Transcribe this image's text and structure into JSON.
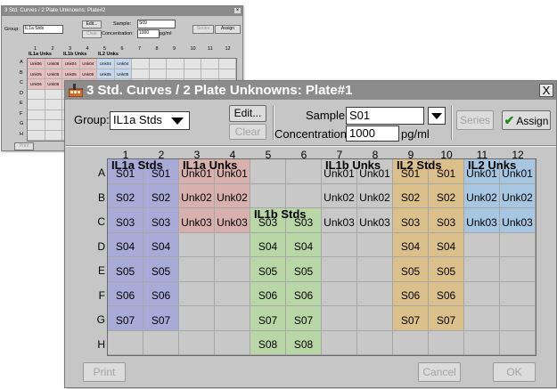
{
  "back_window": {
    "title": "3 Std. Curves / 2 Plate Unknowns: Plate#2",
    "group_label": "Group:",
    "group_value": "IL1a Stds",
    "edit": "Edit...",
    "clear": "Clear",
    "sample_label": "Sample:",
    "sample_value": "S09",
    "conc_label": "Concentration:",
    "conc_value": "1000",
    "unit": "pg/ml",
    "series": "Series",
    "assign": "Assign",
    "print": "Print",
    "columns": [
      "1",
      "2",
      "3",
      "4",
      "5",
      "6",
      "7",
      "8",
      "9",
      "10",
      "11",
      "12"
    ],
    "rows": [
      "A",
      "B",
      "C",
      "D",
      "E",
      "F",
      "G",
      "H"
    ],
    "groups": [
      {
        "label": "IL1a Unks",
        "col": 3
      },
      {
        "label": "IL1b Unks",
        "col": 5
      },
      {
        "label": "IL2 Unks",
        "col": 7
      }
    ],
    "cells": [
      {
        "row": 0,
        "col": 0,
        "text": "Unk06",
        "color": "#e6c0c0"
      },
      {
        "row": 0,
        "col": 1,
        "text": "Unk06",
        "color": "#e6c0c0"
      },
      {
        "row": 0,
        "col": 2,
        "text": "Unk04",
        "color": "#e6c0c0"
      },
      {
        "row": 0,
        "col": 3,
        "text": "Unk04",
        "color": "#e6c0c0"
      },
      {
        "row": 0,
        "col": 4,
        "text": "Unk04",
        "color": "#c8d8ec"
      },
      {
        "row": 0,
        "col": 5,
        "text": "Unk04",
        "color": "#c8d8ec"
      },
      {
        "row": 1,
        "col": 0,
        "text": "Unk05",
        "color": "#e6c0c0"
      },
      {
        "row": 1,
        "col": 1,
        "text": "Unk05",
        "color": "#e6c0c0"
      },
      {
        "row": 1,
        "col": 2,
        "text": "Unk05",
        "color": "#e6c0c0"
      },
      {
        "row": 1,
        "col": 3,
        "text": "Unk05",
        "color": "#e6c0c0"
      },
      {
        "row": 1,
        "col": 4,
        "text": "Unk05",
        "color": "#c8d8ec"
      },
      {
        "row": 1,
        "col": 5,
        "text": "Unk05",
        "color": "#c8d8ec"
      },
      {
        "row": 2,
        "col": 0,
        "text": "Unk06",
        "color": "#e6c0c0"
      },
      {
        "row": 2,
        "col": 1,
        "text": "Unk06",
        "color": "#e6c0c0"
      },
      {
        "row": 2,
        "col": 2,
        "text": "Unk06",
        "color": "#e6c0c0"
      },
      {
        "row": 2,
        "col": 3,
        "text": "Unk06",
        "color": "#e6c0c0"
      },
      {
        "row": 2,
        "col": 4,
        "text": "Unk06",
        "color": "#c8d8ec"
      },
      {
        "row": 2,
        "col": 5,
        "text": "Unk06",
        "color": "#c8d8ec"
      }
    ]
  },
  "window": {
    "title": "3 Std. Curves / 2 Plate Unknowns: Plate#1",
    "close": "X",
    "group_label": "Group:",
    "group_value": "IL1a Stds",
    "edit": "Edit...",
    "clear": "Clear",
    "sample_label": "Sample:",
    "sample_value": "S01",
    "conc_label": "Concentration",
    "conc_value": "1000",
    "unit": "pg/ml",
    "series": "Series",
    "assign": "Assign",
    "print": "Print",
    "cancel": "Cancel",
    "ok": "OK"
  },
  "colors": {
    "il1a_stds": "#a8aad8",
    "il1a_unks": "#d8b0ae",
    "il1b_stds": "#b8d6a6",
    "il2_stds": "#dcc08c",
    "il2_unks": "#a6c6e2",
    "empty": "#c8c8c8",
    "title_bar": "#8c8c8c"
  },
  "plate": {
    "columns": [
      "1",
      "2",
      "3",
      "4",
      "5",
      "6",
      "7",
      "8",
      "9",
      "10",
      "11",
      "12"
    ],
    "rows": [
      "A",
      "B",
      "C",
      "D",
      "E",
      "F",
      "G",
      "H"
    ],
    "groups": [
      {
        "label": "IL1a Stds",
        "row": 0,
        "col": 0
      },
      {
        "label": "IL1a Unks",
        "row": 0,
        "col": 2
      },
      {
        "label": "IL1b Stds",
        "row": 2,
        "col": 4
      },
      {
        "label": "IL1b Unks",
        "row": 0,
        "col": 6
      },
      {
        "label": "IL2 Stds",
        "row": 0,
        "col": 8
      },
      {
        "label": "IL2 Unks",
        "row": 0,
        "col": 10
      }
    ],
    "wells": [
      {
        "row": 0,
        "col": 0,
        "text": "S01",
        "group": "il1a_stds"
      },
      {
        "row": 0,
        "col": 1,
        "text": "S01",
        "group": "il1a_stds"
      },
      {
        "row": 0,
        "col": 2,
        "text": "Unk01",
        "group": "il1a_unks"
      },
      {
        "row": 0,
        "col": 3,
        "text": "Unk01",
        "group": "il1a_unks"
      },
      {
        "row": 0,
        "col": 6,
        "text": "Unk01",
        "group": "empty"
      },
      {
        "row": 0,
        "col": 7,
        "text": "Unk01",
        "group": "empty"
      },
      {
        "row": 0,
        "col": 8,
        "text": "S01",
        "group": "il2_stds"
      },
      {
        "row": 0,
        "col": 9,
        "text": "S01",
        "group": "il2_stds"
      },
      {
        "row": 0,
        "col": 10,
        "text": "Unk01",
        "group": "il2_unks"
      },
      {
        "row": 0,
        "col": 11,
        "text": "Unk01",
        "group": "il2_unks"
      },
      {
        "row": 1,
        "col": 0,
        "text": "S02",
        "group": "il1a_stds"
      },
      {
        "row": 1,
        "col": 1,
        "text": "S02",
        "group": "il1a_stds"
      },
      {
        "row": 1,
        "col": 2,
        "text": "Unk02",
        "group": "il1a_unks"
      },
      {
        "row": 1,
        "col": 3,
        "text": "Unk02",
        "group": "il1a_unks"
      },
      {
        "row": 1,
        "col": 6,
        "text": "Unk02",
        "group": "empty"
      },
      {
        "row": 1,
        "col": 7,
        "text": "Unk02",
        "group": "empty"
      },
      {
        "row": 1,
        "col": 8,
        "text": "S02",
        "group": "il2_stds"
      },
      {
        "row": 1,
        "col": 9,
        "text": "S02",
        "group": "il2_stds"
      },
      {
        "row": 1,
        "col": 10,
        "text": "Unk02",
        "group": "il2_unks"
      },
      {
        "row": 1,
        "col": 11,
        "text": "Unk02",
        "group": "il2_unks"
      },
      {
        "row": 2,
        "col": 0,
        "text": "S03",
        "group": "il1a_stds"
      },
      {
        "row": 2,
        "col": 1,
        "text": "S03",
        "group": "il1a_stds"
      },
      {
        "row": 2,
        "col": 2,
        "text": "Unk03",
        "group": "il1a_unks"
      },
      {
        "row": 2,
        "col": 3,
        "text": "Unk03",
        "group": "il1a_unks"
      },
      {
        "row": 2,
        "col": 4,
        "text": "S03",
        "group": "il1b_stds"
      },
      {
        "row": 2,
        "col": 5,
        "text": "S03",
        "group": "il1b_stds"
      },
      {
        "row": 2,
        "col": 6,
        "text": "Unk03",
        "group": "empty"
      },
      {
        "row": 2,
        "col": 7,
        "text": "Unk03",
        "group": "empty"
      },
      {
        "row": 2,
        "col": 8,
        "text": "S03",
        "group": "il2_stds"
      },
      {
        "row": 2,
        "col": 9,
        "text": "S03",
        "group": "il2_stds"
      },
      {
        "row": 2,
        "col": 10,
        "text": "Unk03",
        "group": "il2_unks"
      },
      {
        "row": 2,
        "col": 11,
        "text": "Unk03",
        "group": "il2_unks"
      },
      {
        "row": 3,
        "col": 0,
        "text": "S04",
        "group": "il1a_stds"
      },
      {
        "row": 3,
        "col": 1,
        "text": "S04",
        "group": "il1a_stds"
      },
      {
        "row": 3,
        "col": 4,
        "text": "S04",
        "group": "il1b_stds"
      },
      {
        "row": 3,
        "col": 5,
        "text": "S04",
        "group": "il1b_stds"
      },
      {
        "row": 3,
        "col": 8,
        "text": "S04",
        "group": "il2_stds"
      },
      {
        "row": 3,
        "col": 9,
        "text": "S04",
        "group": "il2_stds"
      },
      {
        "row": 4,
        "col": 0,
        "text": "S05",
        "group": "il1a_stds"
      },
      {
        "row": 4,
        "col": 1,
        "text": "S05",
        "group": "il1a_stds"
      },
      {
        "row": 4,
        "col": 4,
        "text": "S05",
        "group": "il1b_stds"
      },
      {
        "row": 4,
        "col": 5,
        "text": "S05",
        "group": "il1b_stds"
      },
      {
        "row": 4,
        "col": 8,
        "text": "S05",
        "group": "il2_stds"
      },
      {
        "row": 4,
        "col": 9,
        "text": "S05",
        "group": "il2_stds"
      },
      {
        "row": 5,
        "col": 0,
        "text": "S06",
        "group": "il1a_stds"
      },
      {
        "row": 5,
        "col": 1,
        "text": "S06",
        "group": "il1a_stds"
      },
      {
        "row": 5,
        "col": 4,
        "text": "S06",
        "group": "il1b_stds"
      },
      {
        "row": 5,
        "col": 5,
        "text": "S06",
        "group": "il1b_stds"
      },
      {
        "row": 5,
        "col": 8,
        "text": "S06",
        "group": "il2_stds"
      },
      {
        "row": 5,
        "col": 9,
        "text": "S06",
        "group": "il2_stds"
      },
      {
        "row": 6,
        "col": 0,
        "text": "S07",
        "group": "il1a_stds"
      },
      {
        "row": 6,
        "col": 1,
        "text": "S07",
        "group": "il1a_stds"
      },
      {
        "row": 6,
        "col": 4,
        "text": "S07",
        "group": "il1b_stds"
      },
      {
        "row": 6,
        "col": 5,
        "text": "S07",
        "group": "il1b_stds"
      },
      {
        "row": 6,
        "col": 8,
        "text": "S07",
        "group": "il2_stds"
      },
      {
        "row": 6,
        "col": 9,
        "text": "S07",
        "group": "il2_stds"
      },
      {
        "row": 7,
        "col": 4,
        "text": "S08",
        "group": "il1b_stds"
      },
      {
        "row": 7,
        "col": 5,
        "text": "S08",
        "group": "il1b_stds"
      }
    ]
  }
}
